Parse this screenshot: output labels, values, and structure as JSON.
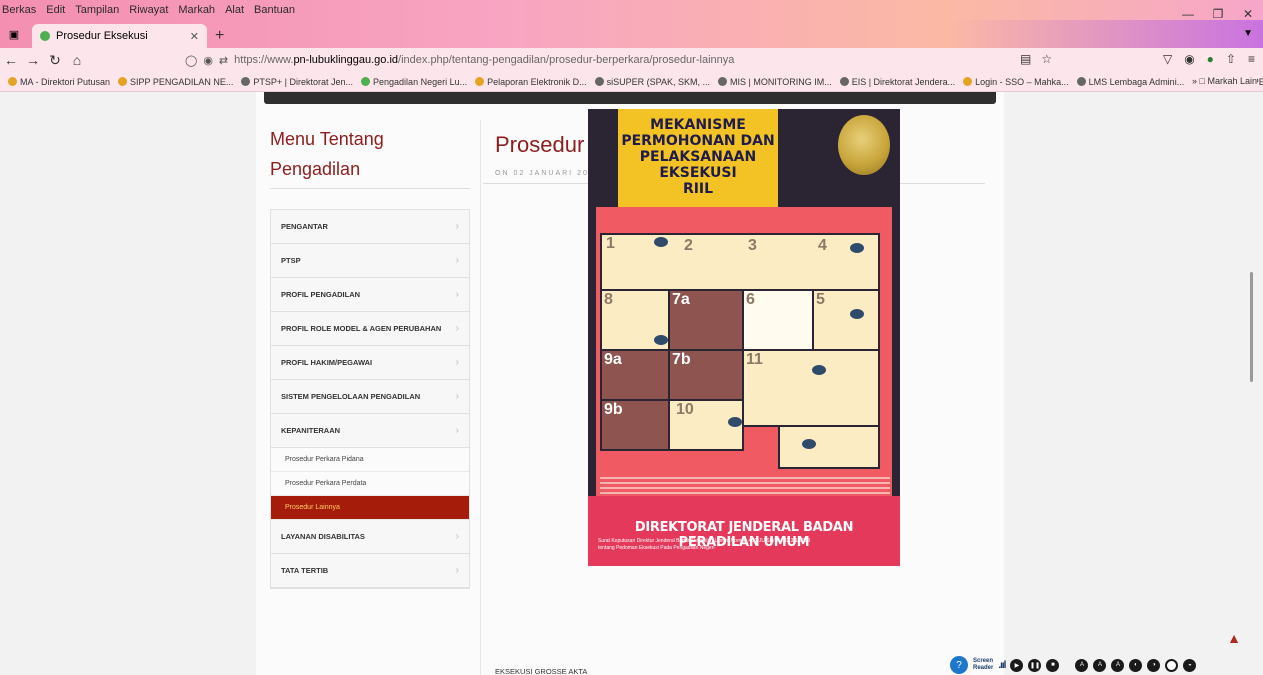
{
  "browser": {
    "menu": [
      "Berkas",
      "Edit",
      "Tampilan",
      "Riwayat",
      "Markah",
      "Alat",
      "Bantuan"
    ],
    "tab_title": "Prosedur Eksekusi",
    "url_prefix": "https://www.",
    "url_domain": "pn-lubuklinggau.go.id",
    "url_path": "/index.php/tentang-pengadilan/prosedur-berperkara/prosedur-lainnya",
    "bookmarks": [
      {
        "label": "MA - Direktori Putusan",
        "color": "#e4a322"
      },
      {
        "label": "SIPP PENGADILAN NE...",
        "color": "#e4a322"
      },
      {
        "label": "PTSP+ | Direktorat Jen...",
        "color": "#666666"
      },
      {
        "label": "Pengadilan Negeri Lu...",
        "color": "#4caf50"
      },
      {
        "label": "Pelaporan Elektronik D...",
        "color": "#e4a322"
      },
      {
        "label": "siSUPER (SPAK, SKM, ...",
        "color": "#666666"
      },
      {
        "label": "MIS | MONITORING IM...",
        "color": "#666666"
      },
      {
        "label": "EIS | Direktorat Jendera...",
        "color": "#666666"
      },
      {
        "label": "Login - SSO – Mahka...",
        "color": "#e4a322"
      },
      {
        "label": "LMS Lembaga Admini...",
        "color": "#666666"
      },
      {
        "label": "REGISTER PENDAFTAR...",
        "color": "#2b4a8a"
      }
    ],
    "bookmarks_overflow": "Markah Lain"
  },
  "sidebar": {
    "title_line1": "Menu Tentang",
    "title_line2": "Pengadilan",
    "items": [
      {
        "label": "PENGANTAR"
      },
      {
        "label": "PTSP"
      },
      {
        "label": "PROFIL PENGADILAN"
      },
      {
        "label": "PROFIL ROLE MODEL & AGEN PERUBAHAN"
      },
      {
        "label": "PROFIL HAKIM/PEGAWAI"
      },
      {
        "label": "SISTEM PENGELOLAAN PENGADILAN"
      },
      {
        "label": "KEPANITERAAN"
      }
    ],
    "sub_items": [
      "Prosedur Perkara Pidana",
      "Prosedur Perkara Perdata",
      "Prosedur Lainnya"
    ],
    "items_after": [
      {
        "label": "LAYANAN DISABILITAS"
      },
      {
        "label": "TATA TERTIB"
      }
    ]
  },
  "content": {
    "title": "Prosedur Lainnya",
    "date": "ON 02 JANUARI 2015.",
    "caption": "EKSEKUSI GROSSE AKTA"
  },
  "poster": {
    "title_lines": [
      "MEKANISME",
      "PERMOHONAN DAN",
      "PELAKSANAAN",
      "EKSEKUSI",
      "RIIL"
    ],
    "footer_title": "DIREKTORAT JENDERAL BADAN PERADILAN UMUM",
    "footer_sub1": "Surat Keputusan Direktur Jenderal Badan Peradilan Umum Nomor: 40/DJU/SK/HM.02.3/1/2019",
    "footer_sub2": "tentang Pedoman Eksekusi Pada Pengadilan Negeri",
    "steps": [
      "1",
      "2",
      "3",
      "4",
      "8",
      "7a",
      "6",
      "5",
      "9a",
      "7b",
      "11",
      "9b",
      "10"
    ]
  },
  "a11y": {
    "screen_reader_line1": "Screen",
    "screen_reader_line2": "Reader"
  }
}
